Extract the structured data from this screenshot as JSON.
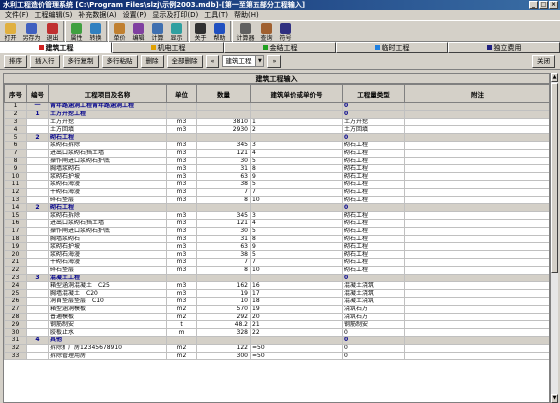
{
  "window": {
    "title": "水利工程造价管理系统 [C:\\Program Files\\slzj\\示例2003.mdb]-[第一至第五部分工程输入]"
  },
  "menu": [
    "文件(F)",
    "工程编辑(S)",
    "补充数据(A)",
    "设置(P)",
    "显示及打印(D)",
    "工具(T)",
    "帮助(H)"
  ],
  "toolbar": [
    {
      "label": "打开",
      "icon": "folder-open-icon",
      "color": "#e0b040"
    },
    {
      "label": "另存为",
      "icon": "save-as-icon",
      "color": "#4060c0"
    },
    {
      "label": "退出",
      "icon": "exit-icon",
      "color": "#c03030"
    },
    {
      "label": "属性",
      "icon": "properties-icon",
      "color": "#40a040"
    },
    {
      "label": "转换",
      "icon": "convert-icon",
      "color": "#3080c0"
    },
    {
      "label": "单价",
      "icon": "unit-price-icon",
      "color": "#c08030"
    },
    {
      "label": "编辑",
      "icon": "edit-icon",
      "color": "#8040a0"
    },
    {
      "label": "计算",
      "icon": "calculate-icon",
      "color": "#4070b0"
    },
    {
      "label": "显示",
      "icon": "display-icon",
      "color": "#30a0a0"
    },
    {
      "label": "关于",
      "icon": "about-icon",
      "color": "#303030"
    },
    {
      "label": "帮助",
      "icon": "help-icon",
      "color": "#2050c0"
    },
    {
      "label": "计算器",
      "icon": "calculator-icon",
      "color": "#606060"
    },
    {
      "label": "查询",
      "icon": "query-icon",
      "color": "#a06030"
    },
    {
      "label": "符号",
      "icon": "symbol-icon",
      "color": "#303080"
    }
  ],
  "tabs": [
    {
      "label": "建筑工程",
      "color": "#d02020",
      "active": true
    },
    {
      "label": "机电工程",
      "color": "#e0a000",
      "active": false
    },
    {
      "label": "金结工程",
      "color": "#20a020",
      "active": false
    },
    {
      "label": "临时工程",
      "color": "#2080e0",
      "active": false
    },
    {
      "label": "独立费用",
      "color": "#202080",
      "active": false
    }
  ],
  "actions": {
    "buttons": [
      "排序",
      "插入行",
      "多行复制",
      "多行粘贴",
      "删除",
      "全部删除"
    ],
    "nav_prev": "«",
    "dropdown": "建筑工程",
    "nav_next": "»",
    "close": "关闭"
  },
  "grid": {
    "caption": "建筑工程输入",
    "headers": [
      "序号",
      "编号",
      "工程项目及名称",
      "单位",
      "数量",
      "建筑单价或单价号",
      "工程量类型",
      "附注"
    ],
    "rows": [
      {
        "n": "1",
        "code": "一",
        "name": "青年路涵洞工程青年路涵洞工程",
        "unit": "",
        "qty": "",
        "price": "",
        "type": "0",
        "note": "",
        "group": true
      },
      {
        "n": "2",
        "code": "1",
        "name": "土方开挖工程",
        "unit": "",
        "qty": "",
        "price": "",
        "type": "0",
        "note": "",
        "group": true
      },
      {
        "n": "3",
        "code": "",
        "name": "土方开挖",
        "unit": "m3",
        "qty": "3810",
        "price": "1",
        "type": "土方开挖",
        "note": ""
      },
      {
        "n": "4",
        "code": "",
        "name": "土方回填",
        "unit": "m3",
        "qty": "2930",
        "price": "2",
        "type": "土方回填",
        "note": ""
      },
      {
        "n": "5",
        "code": "2",
        "name": "砌石工程",
        "unit": "",
        "qty": "",
        "price": "",
        "type": "0",
        "note": "",
        "group": true
      },
      {
        "n": "6",
        "code": "",
        "name": "浆砌石拆除",
        "unit": "m3",
        "qty": "345",
        "price": "3",
        "type": "砌石工程",
        "note": ""
      },
      {
        "n": "7",
        "code": "",
        "name": "进出口浆砌石挡土墙",
        "unit": "m3",
        "qty": "121",
        "price": "4",
        "type": "砌石工程",
        "note": ""
      },
      {
        "n": "8",
        "code": "",
        "name": "操作闸进口浆砌石护底",
        "unit": "m3",
        "qty": "30",
        "price": "5",
        "type": "砌石工程",
        "note": ""
      },
      {
        "n": "9",
        "code": "",
        "name": "胸墙浆砌石",
        "unit": "m3",
        "qty": "31",
        "price": "8",
        "type": "砌石工程",
        "note": ""
      },
      {
        "n": "10",
        "code": "",
        "name": "浆砌石护坡",
        "unit": "m3",
        "qty": "63",
        "price": "9",
        "type": "砌石工程",
        "note": ""
      },
      {
        "n": "11",
        "code": "",
        "name": "浆砌石海漫",
        "unit": "m3",
        "qty": "38",
        "price": "5",
        "type": "砌石工程",
        "note": ""
      },
      {
        "n": "12",
        "code": "",
        "name": "干砌石海漫",
        "unit": "m3",
        "qty": "7",
        "price": "7",
        "type": "砌石工程",
        "note": ""
      },
      {
        "n": "13",
        "code": "",
        "name": "碎石垫层",
        "unit": "m3",
        "qty": "8",
        "price": "10",
        "type": "砌石工程",
        "note": ""
      },
      {
        "n": "14",
        "code": "2",
        "name": "砌石工程",
        "unit": "",
        "qty": "",
        "price": "",
        "type": "0",
        "note": "",
        "group": true
      },
      {
        "n": "15",
        "code": "",
        "name": "浆砌石拆除",
        "unit": "m3",
        "qty": "345",
        "price": "3",
        "type": "砌石工程",
        "note": ""
      },
      {
        "n": "16",
        "code": "",
        "name": "进出口浆砌石挡土墙",
        "unit": "m3",
        "qty": "121",
        "price": "4",
        "type": "砌石工程",
        "note": ""
      },
      {
        "n": "17",
        "code": "",
        "name": "操作闸进口浆砌石护底",
        "unit": "m3",
        "qty": "30",
        "price": "5",
        "type": "砌石工程",
        "note": ""
      },
      {
        "n": "18",
        "code": "",
        "name": "胸墙浆砌石",
        "unit": "m3",
        "qty": "31",
        "price": "8",
        "type": "砌石工程",
        "note": ""
      },
      {
        "n": "19",
        "code": "",
        "name": "浆砌石护坡",
        "unit": "m3",
        "qty": "63",
        "price": "9",
        "type": "砌石工程",
        "note": ""
      },
      {
        "n": "20",
        "code": "",
        "name": "浆砌石海漫",
        "unit": "m3",
        "qty": "38",
        "price": "5",
        "type": "砌石工程",
        "note": ""
      },
      {
        "n": "21",
        "code": "",
        "name": "干砌石海漫",
        "unit": "m3",
        "qty": "7",
        "price": "7",
        "type": "砌石工程",
        "note": ""
      },
      {
        "n": "22",
        "code": "",
        "name": "碎石垫层",
        "unit": "m3",
        "qty": "8",
        "price": "10",
        "type": "砌石工程",
        "note": ""
      },
      {
        "n": "23",
        "code": "3",
        "name": "混凝土工程",
        "unit": "",
        "qty": "",
        "price": "",
        "type": "0",
        "note": "",
        "group": true
      },
      {
        "n": "24",
        "code": "",
        "name": "箱型涵洞混凝土　C25",
        "unit": "m3",
        "qty": "162",
        "price": "16",
        "type": "混凝土浇筑",
        "note": ""
      },
      {
        "n": "25",
        "code": "",
        "name": "胸墙混凝土　C20",
        "unit": "m3",
        "qty": "19",
        "price": "17",
        "type": "混凝土浇筑",
        "note": ""
      },
      {
        "n": "26",
        "code": "",
        "name": "洞首垫层垫层　C10",
        "unit": "m3",
        "qty": "10",
        "price": "18",
        "type": "混凝土浇筑",
        "note": ""
      },
      {
        "n": "27",
        "code": "",
        "name": "箱型涵洞模板",
        "unit": "m2",
        "qty": "570",
        "price": "19",
        "type": "浇筑石方",
        "note": ""
      },
      {
        "n": "28",
        "code": "",
        "name": "普通模板",
        "unit": "m2",
        "qty": "292",
        "price": "20",
        "type": "浇筑石方",
        "note": ""
      },
      {
        "n": "29",
        "code": "",
        "name": "钢筋制安",
        "unit": "t",
        "qty": "48.2",
        "price": "21",
        "type": "钢筋制安",
        "note": ""
      },
      {
        "n": "30",
        "code": "",
        "name": "胶板止水",
        "unit": "m",
        "qty": "328",
        "price": "22",
        "type": "0",
        "note": ""
      },
      {
        "n": "31",
        "code": "4",
        "name": "其他",
        "unit": "",
        "qty": "",
        "price": "",
        "type": "0",
        "note": "",
        "group": true
      },
      {
        "n": "32",
        "code": "",
        "name": "拆除扩广房12345678910",
        "unit": "m2",
        "qty": "122",
        "price": "=50",
        "type": "0",
        "note": ""
      },
      {
        "n": "33",
        "code": "",
        "name": "拆除管理用房",
        "unit": "m2",
        "qty": "300",
        "price": "=50",
        "type": "0",
        "note": ""
      }
    ]
  }
}
